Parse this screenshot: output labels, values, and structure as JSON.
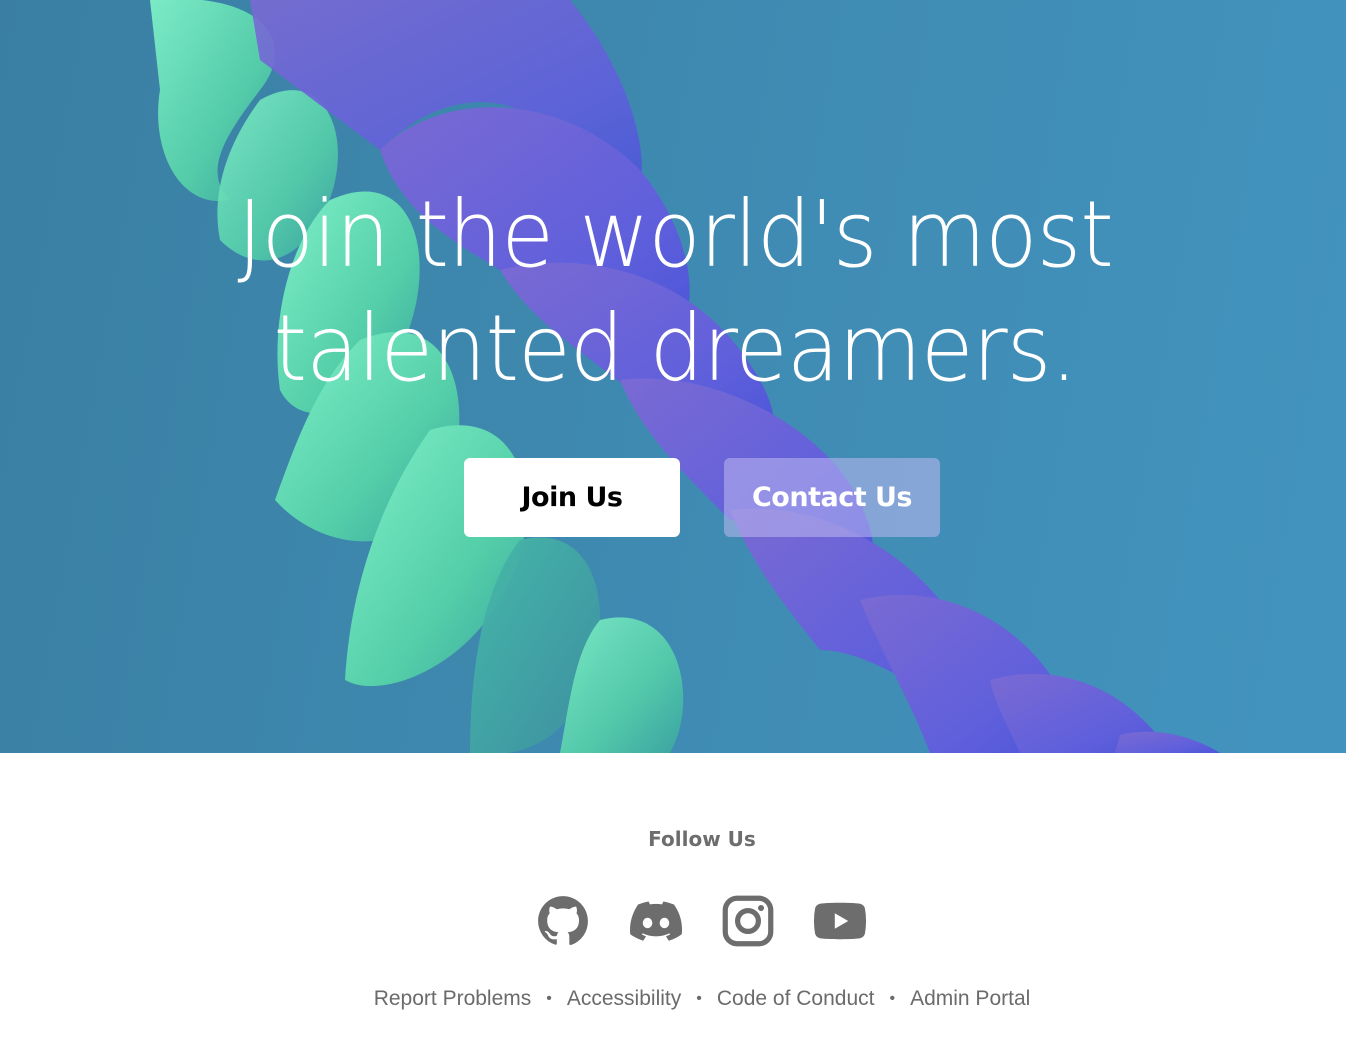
{
  "hero": {
    "title_line1": "Join the world's most",
    "title_line2": "talented dreamers.",
    "join_button": "Join Us",
    "contact_button": "Contact Us"
  },
  "footer": {
    "follow_title": "Follow Us",
    "social": [
      {
        "name": "github-icon"
      },
      {
        "name": "discord-icon"
      },
      {
        "name": "instagram-icon"
      },
      {
        "name": "youtube-icon"
      }
    ],
    "links": [
      "Report Problems",
      "Accessibility",
      "Code of Conduct",
      "Admin Portal"
    ],
    "separator": "•"
  },
  "colors": {
    "hero_background": "#3f8bb3",
    "petal_green": "#5ed0ad",
    "petal_purple": "#6b62d6",
    "footer_text": "#6b6b6b"
  }
}
